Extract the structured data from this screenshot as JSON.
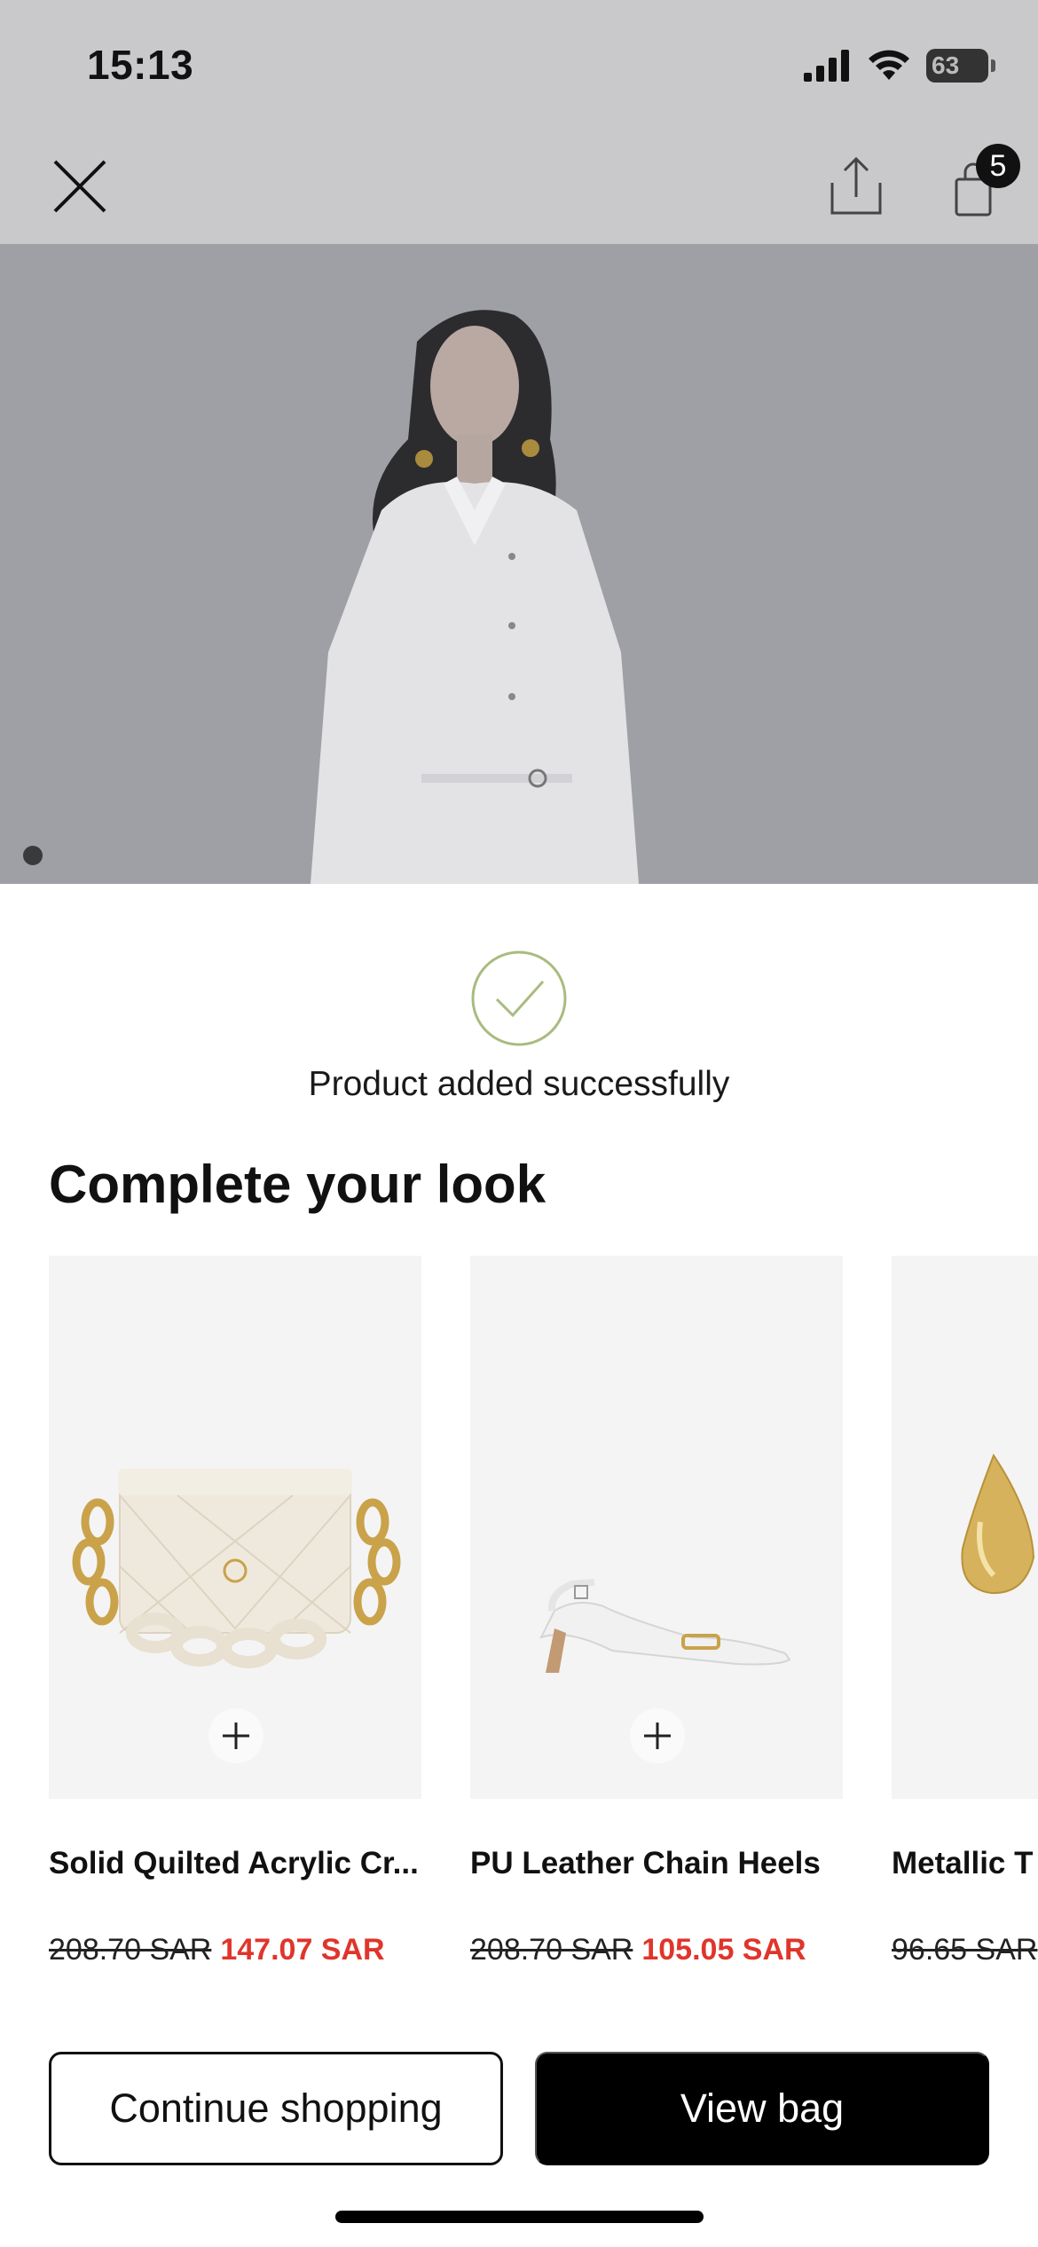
{
  "status_bar": {
    "time": "15:13",
    "battery": "63"
  },
  "nav": {
    "close_icon": "close-icon",
    "share_icon": "share-icon",
    "bag_icon": "shopping-bag-icon",
    "bag_count": "5"
  },
  "confirmation": {
    "icon": "check-circle-icon",
    "message": "Product added successfully"
  },
  "recommendations": {
    "title": "Complete your look",
    "items": [
      {
        "name": "Solid Quilted Acrylic Cr...",
        "old_price": "208.70 SAR",
        "new_price": "147.07 SAR"
      },
      {
        "name": "PU Leather Chain Heels",
        "old_price": "208.70 SAR",
        "new_price": "105.05 SAR"
      },
      {
        "name": "Metallic T",
        "old_price": "96.65 SAR",
        "new_price": ""
      }
    ]
  },
  "actions": {
    "continue_label": "Continue shopping",
    "view_bag_label": "View bag"
  },
  "colors": {
    "accent_sale": "#e0352b",
    "check_green": "#a9bb7f",
    "overlay": "#c9c9cc"
  }
}
